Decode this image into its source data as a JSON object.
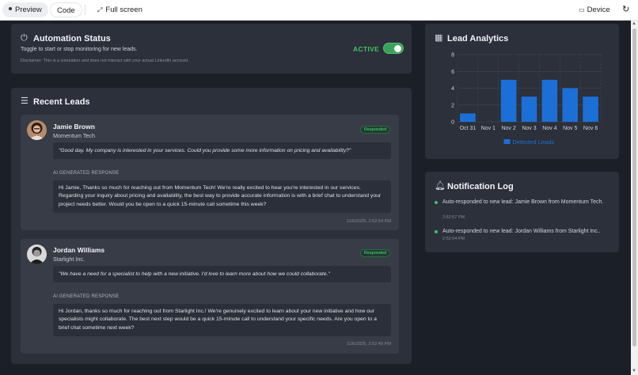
{
  "toolbar": {
    "preview": "Preview",
    "code": "Code",
    "full_screen": "Full screen",
    "device": "Device"
  },
  "automation": {
    "title": "Automation Status",
    "subtitle": "Toggle to start or stop monitoring for new leads.",
    "disclaimer": "Disclaimer: This is a simulation and does not interact with your actual LinkedIn account.",
    "status": "ACTIVE",
    "enabled": true
  },
  "recent_leads": {
    "title": "Recent Leads",
    "ai_label": "AI GENERATED RESPONSE",
    "leads": [
      {
        "name": "Jamie Brown",
        "company": "Momentum Tech",
        "badge": "Responded",
        "message": "\"Good day. My company is interested in your services. Could you provide some more information on pricing and availability?\"",
        "response": "Hi Jamie, Thanks so much for reaching out from Momentum Tech! We're really excited to hear you're interested in our services. Regarding your inquiry about pricing and availability, the best way to provide accurate information is with a brief chat to understand your project needs better. Would you be open to a quick 15-minute call sometime this week?",
        "timestamp": "11/6/2025, 2:52:54 PM"
      },
      {
        "name": "Jordan Williams",
        "company": "Starlight Inc.",
        "badge": "Responded",
        "message": "\"We have a need for a specialist to help with a new initiative. I'd love to learn more about how we could collaborate.\"",
        "response": "Hi Jordan, thanks so much for reaching out from Starlight Inc.! We're genuinely excited to learn about your new initiative and how our specialists might collaborate. The best next step would be a quick 15-minute call to understand your specific needs. Are you open to a brief chat sometime next week?",
        "timestamp": "11/6/2025, 2:52:49 PM"
      }
    ]
  },
  "analytics": {
    "title": "Lead Analytics"
  },
  "chart_data": {
    "type": "bar",
    "categories": [
      "Oct 31",
      "Nov 1",
      "Nov 2",
      "Nov 3",
      "Nov 4",
      "Nov 5",
      "Nov 6"
    ],
    "series": [
      {
        "name": "Detected Leads",
        "values": [
          1,
          0,
          5,
          3,
          5,
          4,
          3
        ]
      }
    ],
    "ylim": [
      0,
      8
    ],
    "yticks": [
      "0",
      "2",
      "4",
      "6",
      "8"
    ],
    "grid": true,
    "legend": "bottom",
    "bar_color": "#1b6fd6"
  },
  "notifications": {
    "title": "Notification Log",
    "items": [
      {
        "text": "Auto-responded to new lead: Jamie Brown from Momentum Tech.",
        "time": "2:52:57 PM"
      },
      {
        "text": "Auto-responded to new lead: Jordan Williams from Starlight Inc..",
        "time": "2:52:54 PM"
      }
    ]
  },
  "colors": {
    "accent_green": "#45c16a",
    "bar_blue": "#1b6fd6",
    "card_bg": "#2b303a"
  }
}
